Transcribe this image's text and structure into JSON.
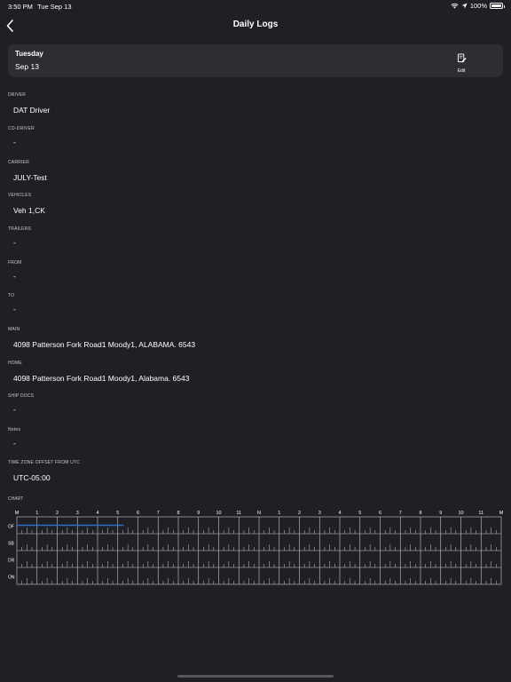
{
  "status_bar": {
    "time": "3:50 PM",
    "date": "Tue Sep 13",
    "battery": "100%",
    "battery_level": 1.0,
    "icons": [
      "wifi-icon",
      "location-arrow-icon",
      "battery-icon"
    ]
  },
  "nav": {
    "title": "Daily Logs",
    "back_icon": "chevron-left-icon"
  },
  "date_card": {
    "day": "Tuesday",
    "date": "Sep 13",
    "edit_label": "Edit",
    "edit_icon": "edit-document-icon"
  },
  "fields": {
    "driver": {
      "label": "DRIVER",
      "value": "DAT Driver"
    },
    "co_driver": {
      "label": "CO-DRIVER",
      "value": "-"
    },
    "carrier": {
      "label": "CARRIER",
      "value": "JULY-Test"
    },
    "vehicles": {
      "label": "VEHICLES",
      "value": "Veh 1,CK"
    },
    "trailers": {
      "label": "TRAILERS",
      "value": "-"
    },
    "from": {
      "label": "FROM",
      "value": "-"
    },
    "to": {
      "label": "TO",
      "value": "-"
    },
    "main": {
      "label": "MAIN",
      "value": "4098  Patterson Fork Road1 Moody1, ALABAMA. 6543"
    },
    "home": {
      "label": "HOME",
      "value": "4098  Patterson Fork Road1 Moody1, Alabama. 6543"
    },
    "ship_docs": {
      "label": "SHIP DOCS",
      "value": "-"
    },
    "notes": {
      "label": "Notes",
      "value": "-"
    },
    "tz_offset": {
      "label": "TIME ZONE OFFSET FROM UTC",
      "value": "UTC-05:00"
    }
  },
  "chart": {
    "label": "CHART",
    "hour_labels": [
      "M",
      "1",
      "2",
      "3",
      "4",
      "5",
      "6",
      "7",
      "8",
      "9",
      "10",
      "11",
      "N",
      "1",
      "2",
      "3",
      "4",
      "5",
      "6",
      "7",
      "8",
      "9",
      "10",
      "11",
      "M"
    ],
    "rows": [
      "OF",
      "SB",
      "DR",
      "ON"
    ],
    "duty_line": {
      "status": "OF",
      "start_hour": 0,
      "end_hour": 5.3
    },
    "colors": {
      "grid": "#c9c9cf",
      "duty_line": "#2f6fc1",
      "background": "#1f1f25"
    }
  }
}
